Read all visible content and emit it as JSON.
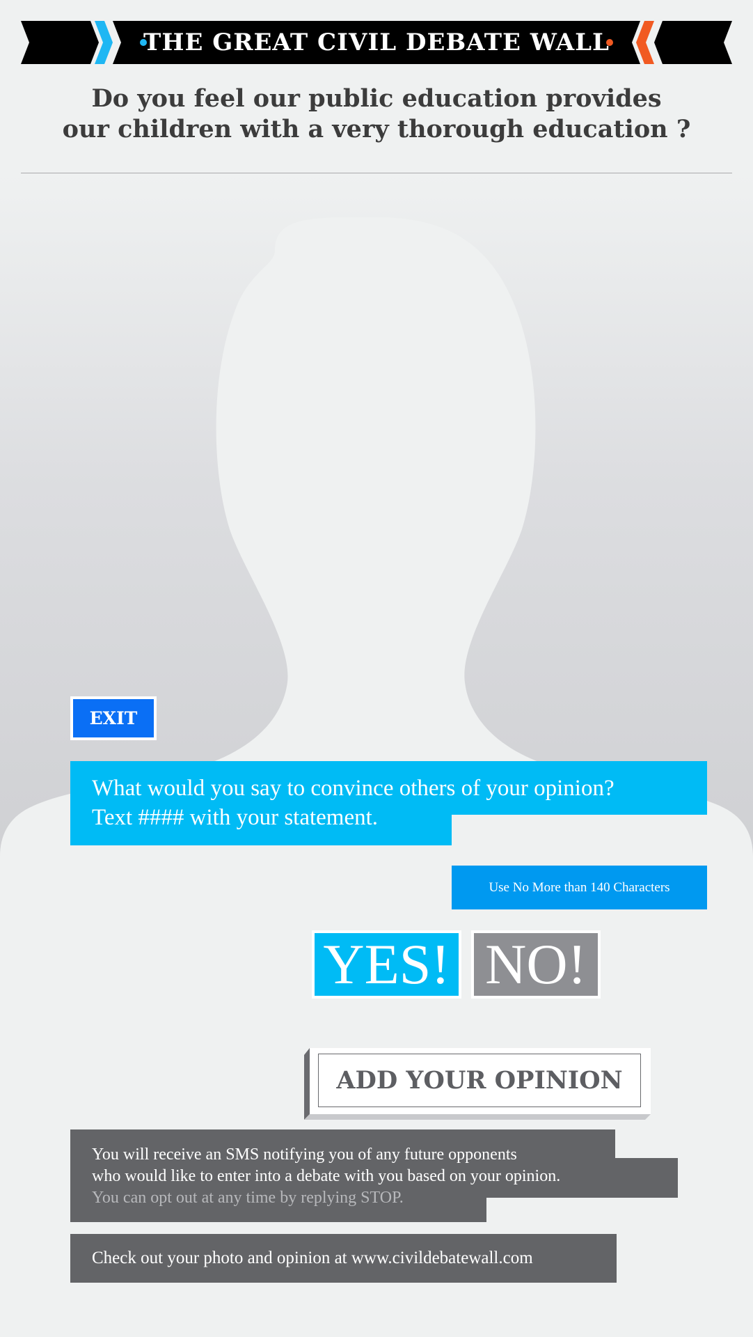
{
  "header": {
    "title": "THE GREAT CIVIL DEBATE WALL"
  },
  "question": {
    "line1": "Do you feel our public education provides",
    "line2": "our children with a very thorough education ?"
  },
  "exit_button": {
    "label": "EXIT"
  },
  "prompt": {
    "line1": "What would you say to convince others of your opinion?",
    "line2": "Text #### with your statement."
  },
  "limit_badge": {
    "label": "Use No More than 140 Characters"
  },
  "stance": {
    "yes_label": "YES!",
    "no_label": "NO!"
  },
  "add_opinion_button": {
    "label": "ADD YOUR OPINION"
  },
  "sms_notice": {
    "line1": "You will receive an SMS notifying you of any future opponents",
    "line2": "who would like to enter into a debate with you based on your opinion.",
    "line3": "You can opt out at any time by replying STOP."
  },
  "site_notice": {
    "text": "Check out your photo and opinion at www.civildebatewall.com"
  },
  "colors": {
    "accent_blue": "#00bbf5",
    "exit_blue": "#0a6ff5",
    "limit_blue": "#0099f0",
    "accent_orange": "#f15a22",
    "neutral_gray": "#8e8f93",
    "dark_gray": "#636467"
  },
  "icons": [
    "chevron-right-icon",
    "chevron-left-icon",
    "person-silhouette-icon"
  ]
}
